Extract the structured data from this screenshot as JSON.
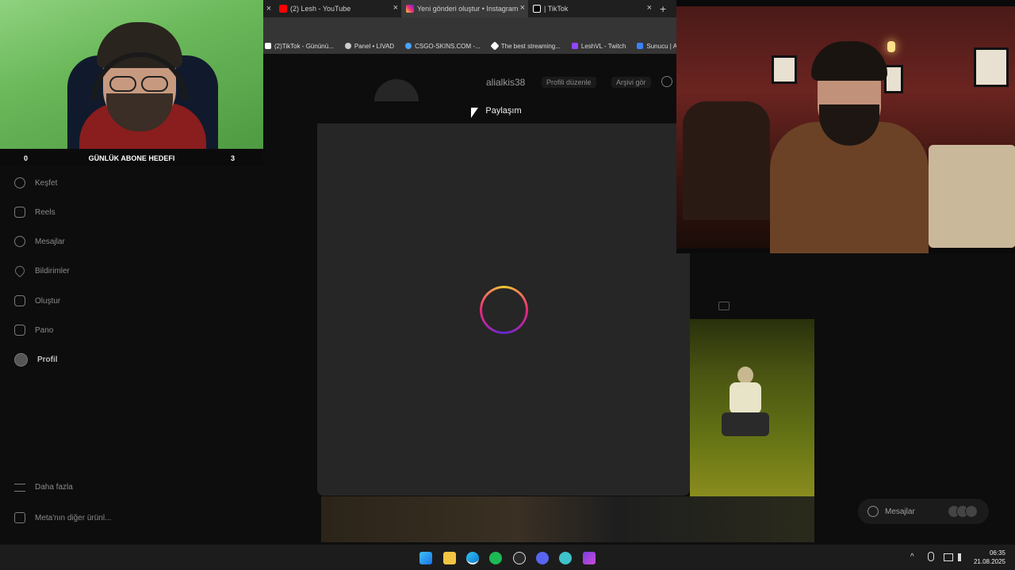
{
  "browser": {
    "tabs": [
      {
        "title": "(2) Lesh - YouTube",
        "icon": "youtube-icon",
        "color": "#ff0000"
      },
      {
        "title": "Yeni gönderi oluştur • Instagram",
        "icon": "instagram-icon",
        "color": "#e1306c",
        "active": true
      },
      {
        "title": "| TikTok",
        "icon": "tiktok-icon",
        "color": "#ffffff"
      }
    ],
    "new_tab": "+",
    "close_glyph": "×",
    "bookmarks": [
      {
        "label": "(2)TikTok - Gününü...",
        "color": "#ffffff"
      },
      {
        "label": "Panel • LIVAD",
        "color": "#cccccc"
      },
      {
        "label": "CSGO-SKINS.COM -...",
        "color": "#4aa3ff"
      },
      {
        "label": "The best streaming...",
        "color": "#ffffff"
      },
      {
        "label": "LeshVL - Twitch",
        "color": "#9146ff"
      },
      {
        "label": "Sunucu | Ate",
        "color": "#3b82f6"
      }
    ]
  },
  "sidebar": {
    "items": [
      {
        "label": "Keşfet",
        "icon": "compass-icon"
      },
      {
        "label": "Reels",
        "icon": "reels-icon"
      },
      {
        "label": "Mesajlar",
        "icon": "messenger-icon"
      },
      {
        "label": "Bildirimler",
        "icon": "heart-icon"
      },
      {
        "label": "Oluştur",
        "icon": "plus-square-icon"
      },
      {
        "label": "Pano",
        "icon": "dashboard-icon"
      },
      {
        "label": "Profil",
        "icon": "avatar"
      }
    ],
    "more": "Daha fazla",
    "meta": "Meta'nın diğer ürünl..."
  },
  "profile": {
    "username": "alialkis38",
    "edit_button": "Profili düzenle",
    "archive_button": "Arşivi gör"
  },
  "modal": {
    "title": "Paylaşım"
  },
  "messages_pill": {
    "label": "Mesajlar"
  },
  "overlay": {
    "goal_left": "0",
    "goal_label": "GÜNLÜK ABONE HEDEFI",
    "goal_right": "3"
  },
  "taskbar": {
    "time": "06:35",
    "date": "21.08.2025"
  }
}
